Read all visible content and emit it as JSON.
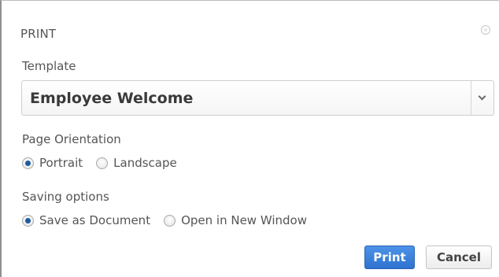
{
  "dialog": {
    "title": "PRINT",
    "close_icon": "close-icon"
  },
  "template": {
    "label": "Template",
    "selected": "Employee Welcome",
    "toggle_icon": "chevron-down-icon"
  },
  "orientation": {
    "label": "Page Orientation",
    "options": [
      {
        "label": "Portrait",
        "checked": true
      },
      {
        "label": "Landscape",
        "checked": false
      }
    ]
  },
  "saving": {
    "label": "Saving options",
    "options": [
      {
        "label": "Save as Document",
        "checked": true
      },
      {
        "label": "Open in New Window",
        "checked": false
      }
    ]
  },
  "buttons": {
    "print_label": "Print",
    "cancel_label": "Cancel"
  },
  "colors": {
    "accent": "#2d72cf",
    "radio_checked": "#1d5a9e"
  }
}
